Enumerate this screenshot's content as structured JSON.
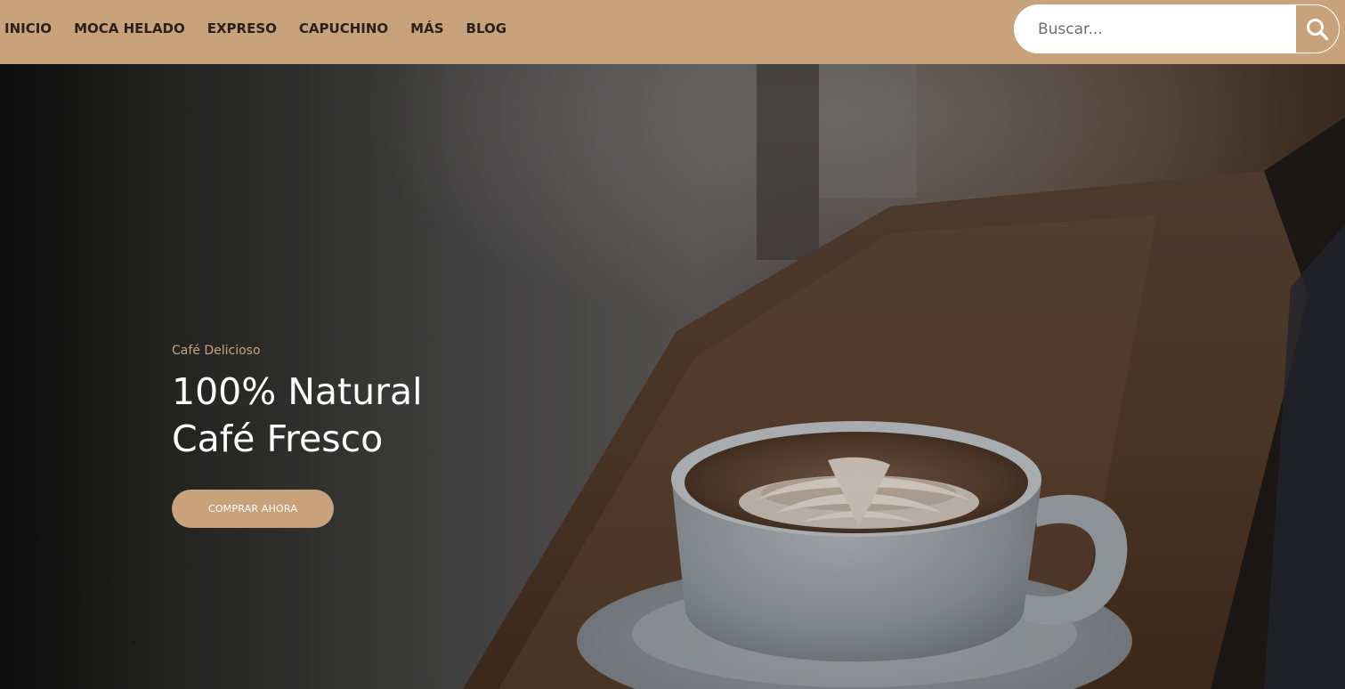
{
  "nav": {
    "items": [
      {
        "label": "INICIO"
      },
      {
        "label": "MOCA HELADO"
      },
      {
        "label": "EXPRESO"
      },
      {
        "label": "CAPUCHINO"
      },
      {
        "label": "MÁS"
      },
      {
        "label": "BLOG"
      }
    ],
    "background": "#c8a27b"
  },
  "search": {
    "placeholder": "Buscar...",
    "value": "",
    "button_icon": "search-icon"
  },
  "hero": {
    "eyebrow": "Café Delicioso",
    "title_line1": "100% Natural",
    "title_line2": "Café Fresco",
    "cta_label": "COMPRAR AHORA",
    "background_image": "latte-art-coffee-cup-on-wooden-table",
    "accent_color": "#c8a27b",
    "title_color": "#ffffff"
  }
}
